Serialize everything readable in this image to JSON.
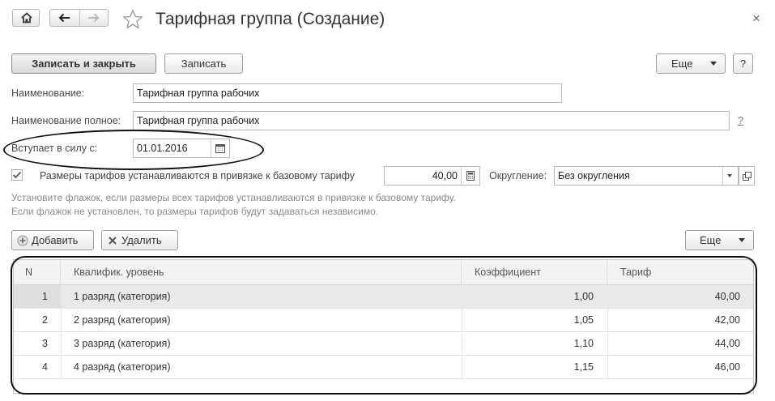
{
  "window": {
    "title": "Тарифная группа (Создание)",
    "close_glyph": "×"
  },
  "toolbar": {
    "save_close_label": "Записать и закрыть",
    "save_label": "Записать",
    "more_label": "Еще",
    "help_label": "?"
  },
  "form": {
    "name_label": "Наименование:",
    "name_value": "Тарифная группа рабочих",
    "full_name_label": "Наименование полное:",
    "full_name_value": "Тарифная группа рабочих",
    "full_name_help": "?",
    "effective_label": "Вступает в силу с:",
    "effective_value": "01.01.2016",
    "base_tariff_checkbox_label": "Размеры тарифов устанавливаются в привязке к базовому тарифу",
    "base_tariff_checked": true,
    "base_tariff_value": "40,00",
    "rounding_label": "Округление:",
    "rounding_value": "Без округления",
    "hint_line1": "Установите флажок, если размеры всех тарифов устанавливаются в привязке к базовому тарифу.",
    "hint_line2": "Если флажок не установлен, то размеры тарифов будут задаваться независимо."
  },
  "table_toolbar": {
    "add_label": "Добавить",
    "delete_label": "Удалить",
    "more_label": "Еще"
  },
  "table": {
    "columns": [
      "N",
      "Квалифик. уровень",
      "Коэффициент",
      "Тариф"
    ],
    "rows": [
      {
        "n": "1",
        "level": "1 разряд (категория)",
        "coef": "1,00",
        "tariff": "40,00"
      },
      {
        "n": "2",
        "level": "2 разряд (категория)",
        "coef": "1,05",
        "tariff": "42,00"
      },
      {
        "n": "3",
        "level": "3 разряд (категория)",
        "coef": "1,10",
        "tariff": "44,00"
      },
      {
        "n": "4",
        "level": "4 разряд (категория)",
        "coef": "1,15",
        "tariff": "46,00"
      }
    ]
  }
}
